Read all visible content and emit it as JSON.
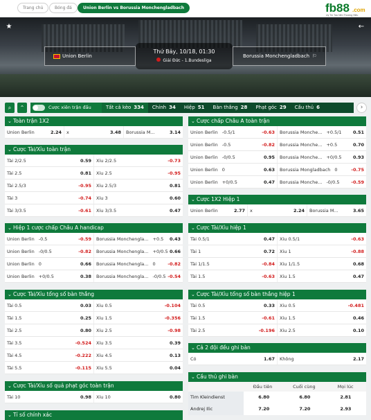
{
  "breadcrumbs": [
    "Trang chủ",
    "Bóng đá",
    "Union Berlin vs Borussia Monchengladbach"
  ],
  "logo": {
    "text": "fb88",
    "suffix": ".com",
    "tagline": "Uy Tín Tạo Nên Thương Hiệu"
  },
  "match": {
    "home": "Union Berlin",
    "away": "Borussia Monchengladbach",
    "datetime": "Thứ Bảy, 10/18, 01:30",
    "league": "Giải Đức - 1.Bundesliga"
  },
  "filters": {
    "toggle_label": "Cược xiên trận đấu",
    "tabs": [
      {
        "label": "Tất cả kèo",
        "count": "334"
      },
      {
        "label": "Chính",
        "count": "34"
      },
      {
        "label": "Hiệp",
        "count": "51"
      },
      {
        "label": "Bàn thắng",
        "count": "28"
      },
      {
        "label": "Phạt góc",
        "count": "29"
      },
      {
        "label": "Cầu thủ",
        "count": "6"
      }
    ]
  },
  "cards": {
    "c1x2": {
      "title": "Toàn trận 1X2",
      "rows": [
        [
          {
            "n": "Union Berlin",
            "o": "2.24"
          },
          {
            "n": "x",
            "o": "3.48"
          },
          {
            "n": "Borussia M...",
            "o": "3.14"
          }
        ]
      ]
    },
    "ou": {
      "title": "Cược Tài/Xỉu toàn trận",
      "rows": [
        [
          {
            "n": "Tài 2/2.5",
            "o": "0.59"
          },
          {
            "n": "Xỉu 2/2.5",
            "o": "-0.73"
          }
        ],
        [
          {
            "n": "Tài 2.5",
            "o": "0.81"
          },
          {
            "n": "Xỉu 2.5",
            "o": "-0.95"
          }
        ],
        [
          {
            "n": "Tài 2.5/3",
            "o": "-0.95"
          },
          {
            "n": "Xỉu 2.5/3",
            "o": "0.81"
          }
        ],
        [
          {
            "n": "Tài 3",
            "o": "-0.74"
          },
          {
            "n": "Xỉu 3",
            "o": "0.60"
          }
        ],
        [
          {
            "n": "Tài 3/3.5",
            "o": "-0.61"
          },
          {
            "n": "Xỉu 3/3.5",
            "o": "0.47"
          }
        ]
      ]
    },
    "h1ah": {
      "title": "Hiệp 1 cược chấp Châu A handicap",
      "rows": [
        [
          {
            "n": "Union Berlin",
            "h": "-0.5",
            "o": "-0.59"
          },
          {
            "n": "Borussia Monchengla...",
            "h": "+0.5",
            "o": "0.43"
          }
        ],
        [
          {
            "n": "Union Berlin",
            "h": "-0/0.5",
            "o": "-0.82"
          },
          {
            "n": "Borussia Monchengla...",
            "h": "+0/0.5",
            "o": "0.66"
          }
        ],
        [
          {
            "n": "Union Berlin",
            "h": "0",
            "o": "0.66"
          },
          {
            "n": "Borussia Monchengla...",
            "h": "0",
            "o": "-0.82"
          }
        ],
        [
          {
            "n": "Union Berlin",
            "h": "+0/0.5",
            "o": "0.38"
          },
          {
            "n": "Borussia Monchengla...",
            "h": "-0/0.5",
            "o": "-0.54"
          }
        ]
      ]
    },
    "goals": {
      "title": "Cược Tài/Xỉu tổng số bàn thắng",
      "rows": [
        [
          {
            "n": "Tài 0.5",
            "o": "0.03"
          },
          {
            "n": "Xỉu 0.5",
            "o": "-0.104"
          }
        ],
        [
          {
            "n": "Tài 1.5",
            "o": "0.25"
          },
          {
            "n": "Xỉu 1.5",
            "o": "-0.356"
          }
        ],
        [
          {
            "n": "Tài 2.5",
            "o": "0.80"
          },
          {
            "n": "Xỉu 2.5",
            "o": "-0.98"
          }
        ],
        [
          {
            "n": "Tài 3.5",
            "o": "-0.524"
          },
          {
            "n": "Xỉu 3.5",
            "o": "0.39"
          }
        ],
        [
          {
            "n": "Tài 4.5",
            "o": "-0.222"
          },
          {
            "n": "Xỉu 4.5",
            "o": "0.13"
          }
        ],
        [
          {
            "n": "Tài 5.5",
            "o": "-0.115"
          },
          {
            "n": "Xỉu 5.5",
            "o": "0.04"
          }
        ]
      ]
    },
    "corners": {
      "title": "Cược Tài/Xỉu số quả phạt góc toàn trận",
      "rows": [
        [
          {
            "n": "Tài 10",
            "o": "0.98"
          },
          {
            "n": "Xỉu 10",
            "o": "0.80"
          }
        ]
      ]
    },
    "exact": {
      "title": "Tỉ số chính xác"
    },
    "ah": {
      "title": "Cược chấp Châu A toàn trận",
      "rows": [
        [
          {
            "n": "Union Berlin",
            "h": "-0.5/1",
            "o": "-0.63"
          },
          {
            "n": "Borussia Monche...",
            "h": "+0.5/1",
            "o": "0.51"
          }
        ],
        [
          {
            "n": "Union Berlin",
            "h": "-0.5",
            "o": "-0.82"
          },
          {
            "n": "Borussia Monche...",
            "h": "+0.5",
            "o": "0.70"
          }
        ],
        [
          {
            "n": "Union Berlin",
            "h": "-0/0.5",
            "o": "0.95"
          },
          {
            "n": "Borussia Monche...",
            "h": "+0/0.5",
            "o": "0.93"
          }
        ],
        [
          {
            "n": "Union Berlin",
            "h": "0",
            "o": "0.63"
          },
          {
            "n": "Borussia Mongladbach",
            "h": "0",
            "o": "-0.75"
          }
        ],
        [
          {
            "n": "Union Berlin",
            "h": "+0/0.5",
            "o": "0.47"
          },
          {
            "n": "Borussia Monche...",
            "h": "-0/0.5",
            "o": "-0.59"
          }
        ]
      ]
    },
    "h1x2": {
      "title": "Cược 1X2 Hiệp 1",
      "rows": [
        [
          {
            "n": "Union Berlin",
            "o": "2.77"
          },
          {
            "n": "x",
            "o": "2.24"
          },
          {
            "n": "Borussia M...",
            "o": "3.65"
          }
        ]
      ]
    },
    "h1ou": {
      "title": "Cược Tài/Xỉu hiệp 1",
      "rows": [
        [
          {
            "n": "Tài 0.5/1",
            "o": "0.47"
          },
          {
            "n": "Xỉu 0.5/1",
            "o": "-0.63"
          }
        ],
        [
          {
            "n": "Tài 1",
            "o": "0.72"
          },
          {
            "n": "Xỉu 1",
            "o": "-0.88"
          }
        ],
        [
          {
            "n": "Tài 1/1.5",
            "o": "-0.84"
          },
          {
            "n": "Xỉu 1/1.5",
            "o": "0.68"
          }
        ],
        [
          {
            "n": "Tài 1.5",
            "o": "-0.63"
          },
          {
            "n": "Xỉu 1.5",
            "o": "0.47"
          }
        ]
      ]
    },
    "h1goals": {
      "title": "Cược Tài/Xỉu tổng số bàn thắng hiệp 1",
      "rows": [
        [
          {
            "n": "Tài 0.5",
            "o": "0.33"
          },
          {
            "n": "Xỉu 0.5",
            "o": "-0.481"
          }
        ],
        [
          {
            "n": "Tài 1.5",
            "o": "-0.61"
          },
          {
            "n": "Xỉu 1.5",
            "o": "0.46"
          }
        ],
        [
          {
            "n": "Tài 2.5",
            "o": "-0.196"
          },
          {
            "n": "Xỉu 2.5",
            "o": "0.10"
          }
        ]
      ]
    },
    "btts": {
      "title": "Cả 2 đội đều ghi bàn",
      "rows": [
        [
          {
            "n": "Có",
            "o": "1.67"
          },
          {
            "n": "Không",
            "o": "2.17"
          }
        ]
      ]
    },
    "scorer": {
      "title": "Cầu thủ ghi bàn",
      "headers": [
        "",
        "Đầu tiên",
        "Cuối cùng",
        "Mọi lúc"
      ],
      "rows": [
        [
          "Tim Kleindienst",
          "6.80",
          "6.80",
          "2.81"
        ],
        [
          "Andrej Ilic",
          "7.20",
          "7.20",
          "2.93"
        ]
      ]
    }
  }
}
